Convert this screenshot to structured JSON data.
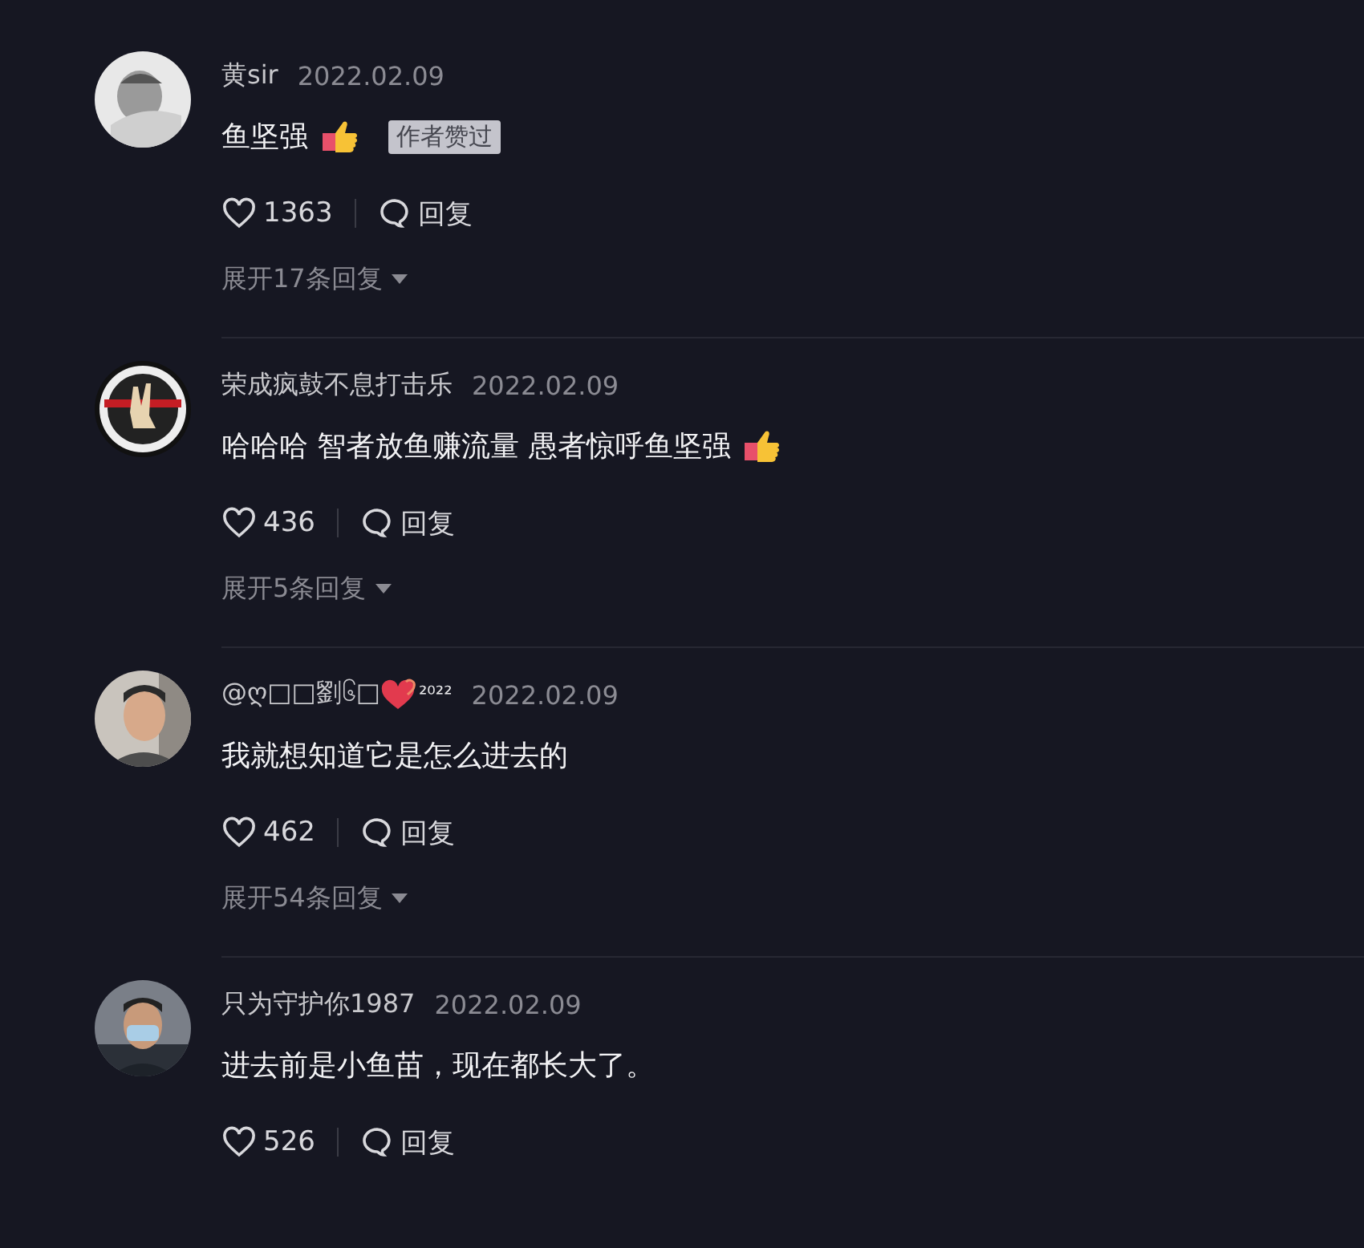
{
  "comments": [
    {
      "name": "黄sir",
      "date": "2022.02.09",
      "text": "鱼坚强",
      "thumbs_up": true,
      "badge": "作者赞过",
      "likes": "1363",
      "reply": "回复",
      "expand": "展开17条回复"
    },
    {
      "name": "荣成疯鼓不息打击乐",
      "date": "2022.02.09",
      "text": "哈哈哈 智者放鱼赚流量 愚者惊呼鱼坚强",
      "thumbs_up": true,
      "likes": "436",
      "reply": "回复",
      "expand": "展开5条回复"
    },
    {
      "name": "@ღ□□劉၆□",
      "hearts_icon": true,
      "name_suffix": "²⁰²²",
      "date": "2022.02.09",
      "text": "我就想知道它是怎么进去的",
      "likes": "462",
      "reply": "回复",
      "expand": "展开54条回复"
    },
    {
      "name": "只为守护你1987",
      "date": "2022.02.09",
      "text": "进去前是小鱼苗，现在都长大了。",
      "likes": "526",
      "reply": "回复"
    }
  ]
}
